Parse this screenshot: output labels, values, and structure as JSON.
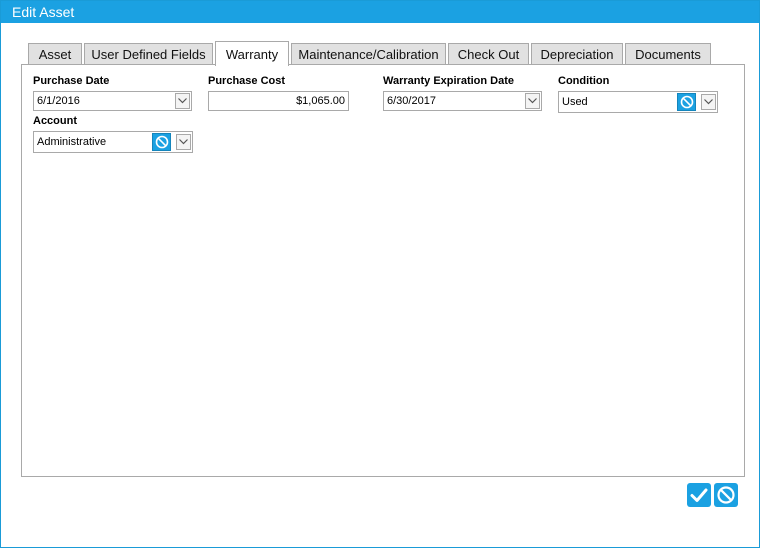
{
  "window": {
    "title": "Edit Asset"
  },
  "tabs": [
    {
      "label": "Asset"
    },
    {
      "label": "User Defined Fields"
    },
    {
      "label": "Warranty"
    },
    {
      "label": "Maintenance/Calibration"
    },
    {
      "label": "Check Out"
    },
    {
      "label": "Depreciation"
    },
    {
      "label": "Documents"
    }
  ],
  "active_tab": "Warranty",
  "form": {
    "purchase_date": {
      "label": "Purchase Date",
      "value": "6/1/2016"
    },
    "purchase_cost": {
      "label": "Purchase Cost",
      "value": "$1,065.00"
    },
    "warranty_expiration": {
      "label": "Warranty Expiration Date",
      "value": "6/30/2017"
    },
    "condition": {
      "label": "Condition",
      "value": "Used"
    },
    "account": {
      "label": "Account",
      "value": "Administrative"
    }
  },
  "icons": {
    "dropdown": "chevron-down-icon",
    "clear": "no-entry-icon",
    "save": "checkmark-icon",
    "cancel": "cancel-icon"
  },
  "colors": {
    "accent": "#1ba1e2",
    "title_text": "#ffffff",
    "tab_inactive": "#e1e1e1",
    "border": "#a9a9a9"
  }
}
